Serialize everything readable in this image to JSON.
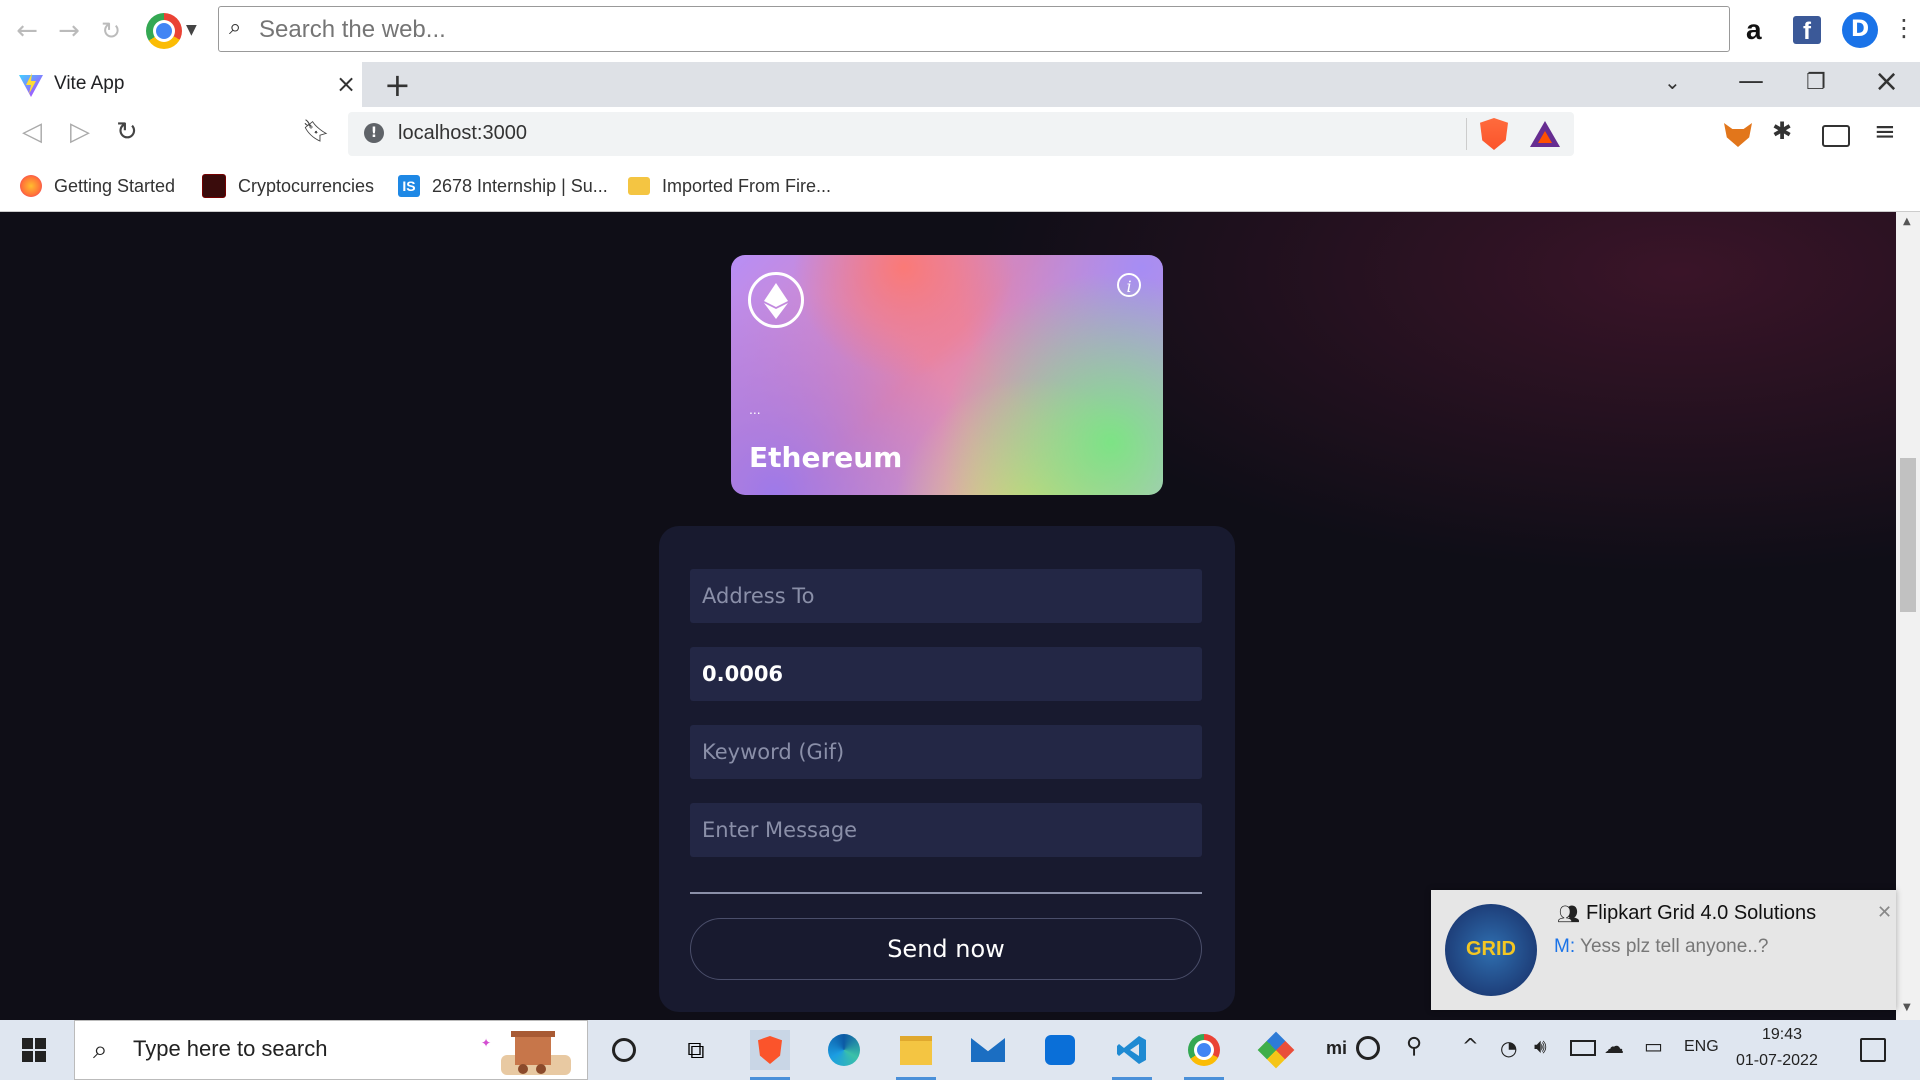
{
  "top_toolbar": {
    "search_placeholder": "Search the web...",
    "amazon_glyph": "a",
    "facebook_glyph": "f",
    "profile_initial": "D"
  },
  "tab": {
    "title": "Vite App"
  },
  "address_bar": {
    "url": "localhost:3000"
  },
  "bookmarks": [
    {
      "label": "Getting Started",
      "icon": "firefox-icon",
      "color": "#ff7139"
    },
    {
      "label": "Cryptocurrencies",
      "icon": "crypto-icon",
      "color": "#3a0c0c"
    },
    {
      "label": "2678 Internship | Su...",
      "icon": "is-icon",
      "color": "#1e88e5"
    },
    {
      "label": "Imported From Fire...",
      "icon": "folder-icon",
      "color": "#f4c542"
    }
  ],
  "card": {
    "address": "...",
    "name": "Ethereum"
  },
  "form": {
    "address_placeholder": "Address To",
    "amount_value": "0.0006",
    "keyword_placeholder": "Keyword (Gif)",
    "message_placeholder": "Enter Message",
    "send_label": "Send now"
  },
  "notification": {
    "title": "Flipkart Grid 4.0 Solutions",
    "sender": "M:",
    "message": " Yess plz tell anyone..?",
    "avatar_text": "GRID"
  },
  "taskbar": {
    "search_placeholder": "Type here to search",
    "language": "ENG",
    "time": "19:43",
    "date": "01-07-2022",
    "mi_label": "mi"
  },
  "colors": {
    "page_background": "#0f0e17",
    "panel": "#181a2f",
    "field": "#232745",
    "accent_blue": "#1a73e8"
  }
}
